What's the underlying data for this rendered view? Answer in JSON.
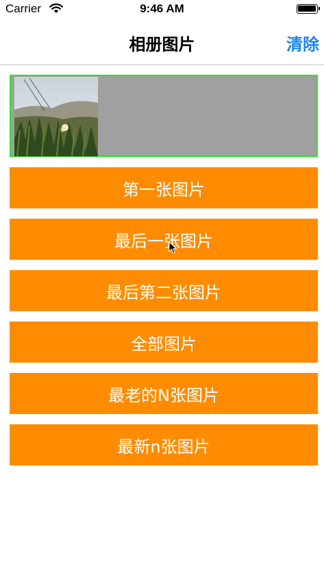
{
  "status_bar": {
    "carrier": "Carrier",
    "time": "9:46 AM"
  },
  "nav": {
    "title": "相册图片",
    "clear_label": "清除"
  },
  "buttons": [
    {
      "label": "第一张图片"
    },
    {
      "label": "最后一张图片"
    },
    {
      "label": "最后第二张图片"
    },
    {
      "label": "全部图片"
    },
    {
      "label": "最老的N张图片"
    },
    {
      "label": "最新n张图片"
    }
  ],
  "colors": {
    "accent": "#1c86ee",
    "button_bg": "#ff8c00",
    "image_border": "#2ee02e",
    "image_bg": "#a0a0a0"
  },
  "icons": {
    "wifi": "wifi-icon",
    "battery": "battery-icon",
    "cursor": "mouse-pointer-icon"
  }
}
